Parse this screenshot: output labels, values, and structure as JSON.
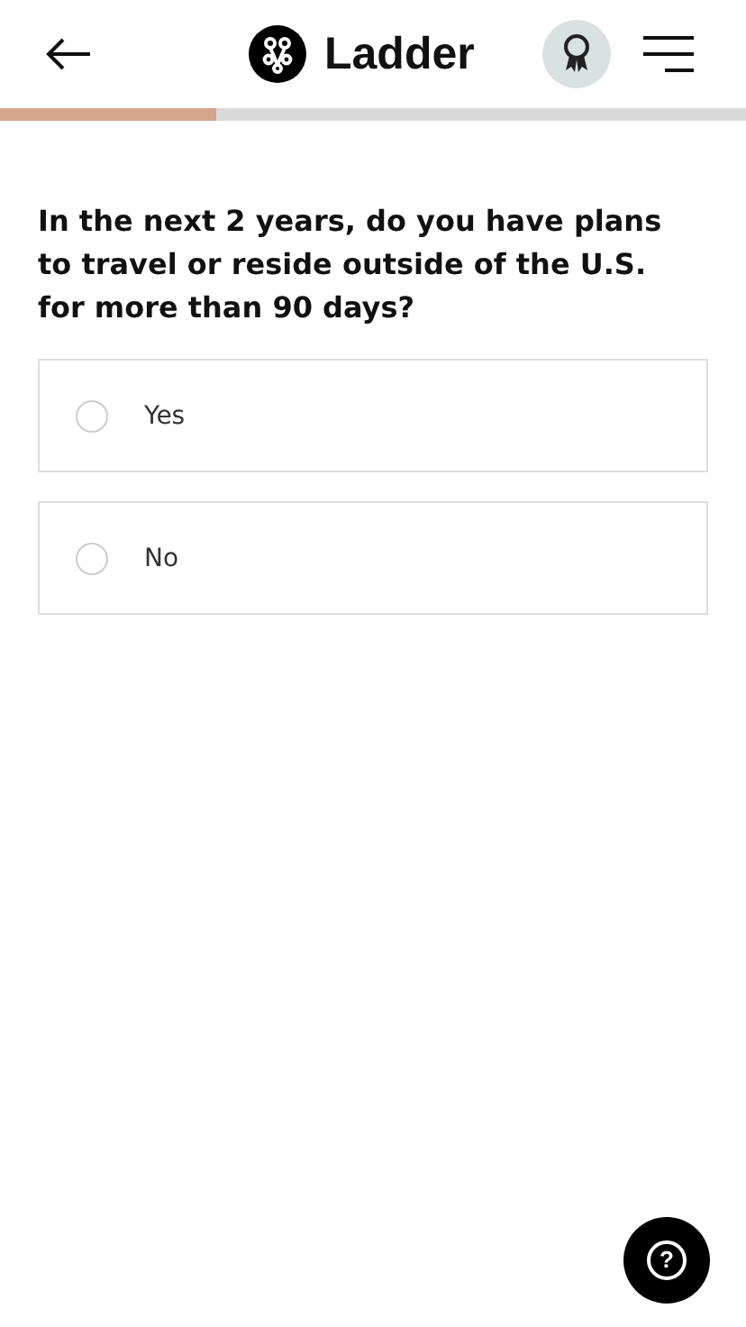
{
  "header": {
    "brand": "Ladder"
  },
  "progress": {
    "level": 0.29
  },
  "question": "In the next 2 years, do you have plans to travel or reside outside of the U.S. for more than 90 days?",
  "options": [
    {
      "label": "Yes",
      "selected": false
    },
    {
      "label": "No",
      "selected": false
    }
  ],
  "help": {
    "symbol": "?"
  }
}
